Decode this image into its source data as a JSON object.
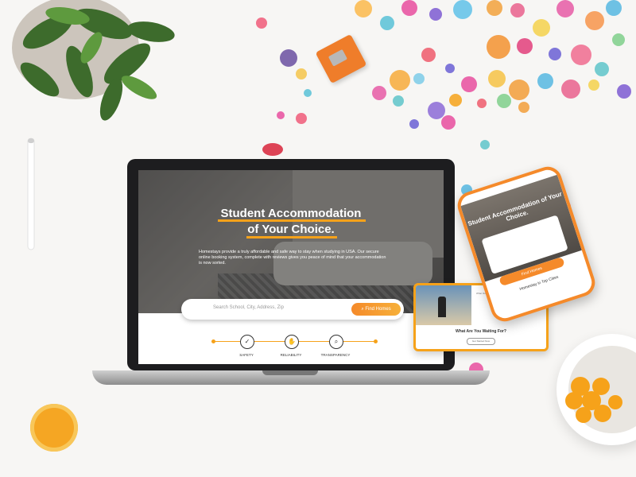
{
  "laptop_site": {
    "hero_title_line1": "Student Accommodation",
    "hero_title_line2": "of Your Choice.",
    "hero_description": "Homestays provide a truly affordable and safe way to stay when studying in USA. Our secure online booking system, complete with reviews gives you peace of mind that your accommodation is now sorted.",
    "search_placeholder": "Search School, City, Address, Zip",
    "find_button": "Find Homes",
    "features": [
      {
        "label": "SAFETY",
        "icon": "shield-icon"
      },
      {
        "label": "RELIABILITY",
        "icon": "handshake-icon"
      },
      {
        "label": "TRANSPARENCY",
        "icon": "magnifier-icon"
      }
    ]
  },
  "tablet_site": {
    "heading": "What Are You Waiting For?",
    "text": "What Our Users Say",
    "button": "Get Started Now"
  },
  "phone_site": {
    "title": "Student Accommodation of Your Choice.",
    "find_button": "Find Homes",
    "subtitle": "Homestay in Top Cities"
  },
  "colors": {
    "accent": "#f6a21a",
    "orange": "#f58a2a",
    "background": "#f7f6f4"
  }
}
